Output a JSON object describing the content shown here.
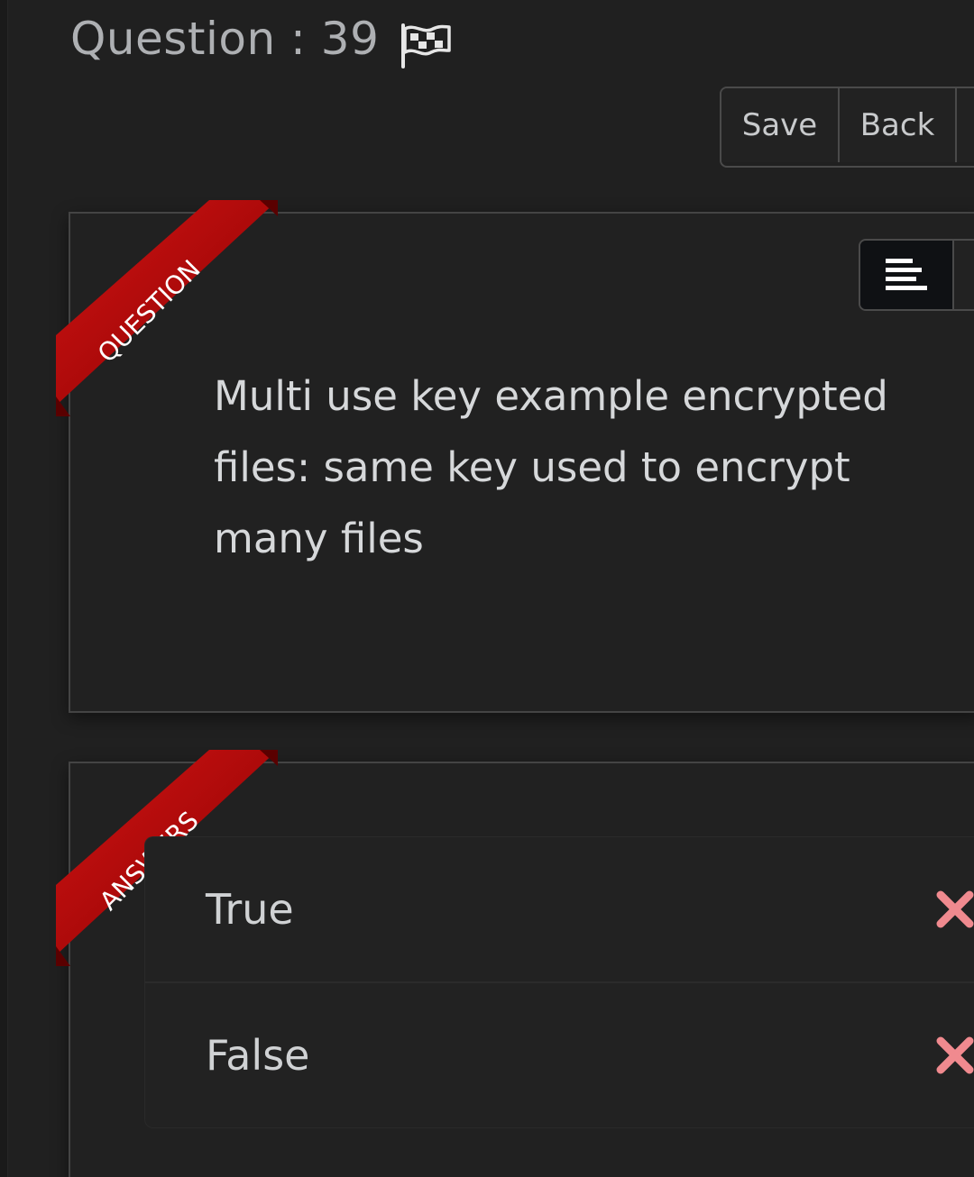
{
  "header": {
    "question_title": "Question : 39",
    "flag_icon": "flag-icon"
  },
  "toolbar": {
    "save_label": "Save",
    "back_label": "Back"
  },
  "question_panel": {
    "ribbon_label": "QUESTION",
    "align_icon": "align-left-icon",
    "text": "Multi use key example encrypted files: same key used to encrypt many files"
  },
  "answers_panel": {
    "ribbon_label": "ANSWERS",
    "items": [
      {
        "label": "True",
        "status_icon": "x-icon"
      },
      {
        "label": "False",
        "status_icon": "x-icon"
      }
    ]
  },
  "colors": {
    "background": "#202020",
    "ribbon_red": "#b00000",
    "wrong_mark": "#f08a8f",
    "text_light": "#d6d8da"
  }
}
